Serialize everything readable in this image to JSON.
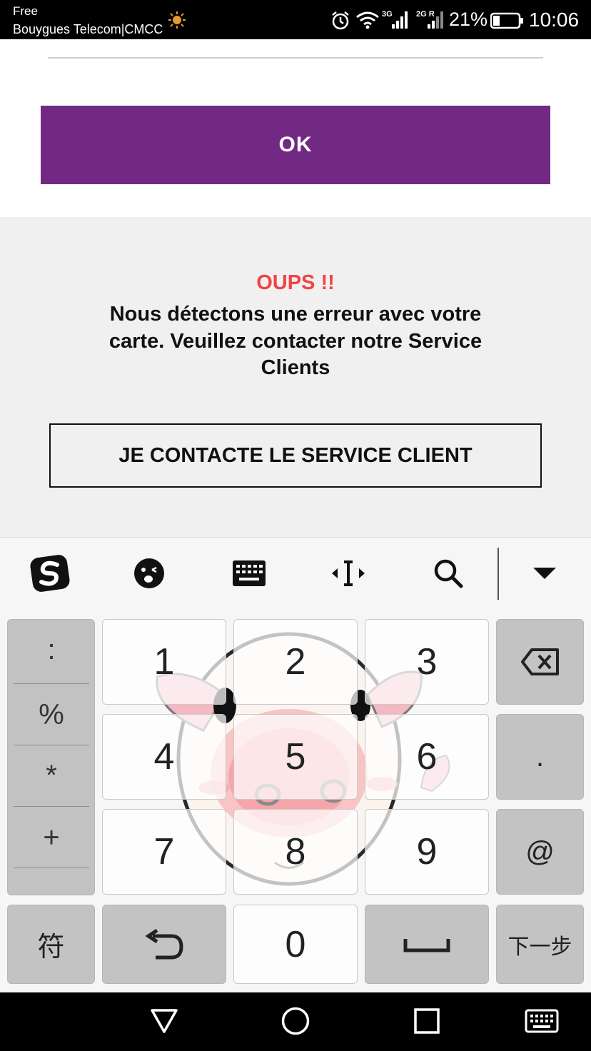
{
  "status_bar": {
    "carrier_line1": "Free",
    "carrier_line2": "Bouygues Telecom|CMCC",
    "network_1": "3G",
    "network_2": "2G R",
    "battery": "21%",
    "time": "10:06"
  },
  "form": {
    "ok_label": "OK",
    "accent_color": "#722984"
  },
  "error": {
    "title": "OUPS !!",
    "message": "Nous détectons une erreur avec votre carte. Veuillez contacter notre Service Clients",
    "contact_button": "JE CONTACTE LE SERVICE CLIENT",
    "title_color": "#ef4444"
  },
  "keyboard": {
    "toolbar_icons": [
      "sogou-logo-icon",
      "emoji-icon",
      "keyboard-icon",
      "cursor-icon",
      "search-icon",
      "collapse-icon"
    ],
    "symbols": [
      ":",
      "%",
      "*",
      "+"
    ],
    "digits": [
      "1",
      "2",
      "3",
      "4",
      "5",
      "6",
      "7",
      "8",
      "9",
      "0"
    ],
    "dot": ".",
    "at": "@",
    "symbols_key": "符",
    "next_key": "下一步"
  },
  "nav_bar": {
    "icons": [
      "back-icon",
      "home-icon",
      "recents-icon",
      "keyboard-switch-icon"
    ]
  }
}
